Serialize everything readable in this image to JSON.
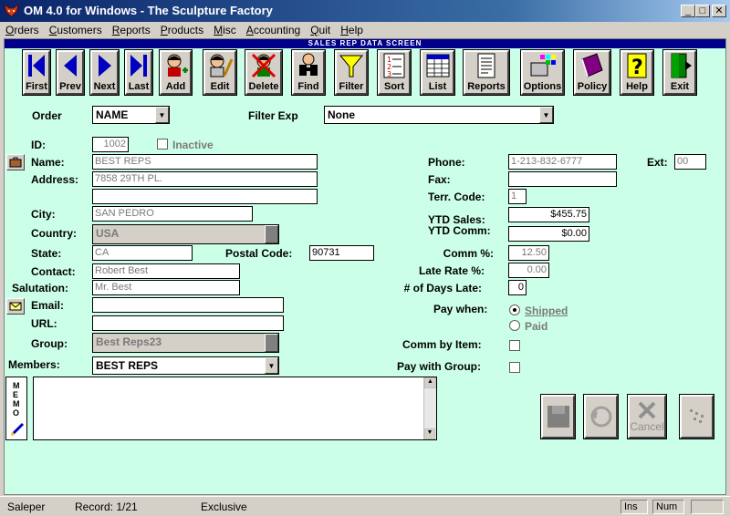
{
  "window": {
    "title": "OM 4.0 for Windows - The Sculpture Factory"
  },
  "menu": [
    "Orders",
    "Customers",
    "Reports",
    "Products",
    "Misc",
    "Accounting",
    "Quit",
    "Help"
  ],
  "screen_title": "SALES REP DATA SCREEN",
  "toolbar": {
    "first": "First",
    "prev": "Prev",
    "next": "Next",
    "last": "Last",
    "add": "Add",
    "edit": "Edit",
    "delete": "Delete",
    "find": "Find",
    "filter": "Filter",
    "sort": "Sort",
    "list": "List",
    "reports": "Reports",
    "options": "Options",
    "policy": "Policy",
    "help": "Help",
    "exit": "Exit"
  },
  "order": {
    "label": "Order",
    "value": "NAME"
  },
  "filter_exp": {
    "label": "Filter Exp",
    "value": "None"
  },
  "form": {
    "id": {
      "label": "ID:",
      "value": "1002"
    },
    "inactive": {
      "label": "Inactive",
      "checked": false
    },
    "name": {
      "label": "Name:",
      "value": "BEST REPS"
    },
    "address": {
      "label": "Address:",
      "line1": "7858 29TH PL.",
      "line2": ""
    },
    "city": {
      "label": "City:",
      "value": "SAN PEDRO"
    },
    "country": {
      "label": "Country:",
      "value": "USA"
    },
    "state": {
      "label": "State:",
      "value": "CA"
    },
    "postal_code": {
      "label": "Postal Code:",
      "value": "90731"
    },
    "contact": {
      "label": "Contact:",
      "value": "Robert Best"
    },
    "salutation": {
      "label": "Salutation:",
      "value": "Mr. Best"
    },
    "email": {
      "label": "Email:",
      "value": ""
    },
    "url": {
      "label": "URL:",
      "value": ""
    },
    "group": {
      "label": "Group:",
      "value": "Best Reps23"
    },
    "members": {
      "label": "Members:",
      "value": "BEST REPS"
    },
    "memo_label": "MEMO",
    "memo": "",
    "phone": {
      "label": "Phone:",
      "value": "1-213-832-6777"
    },
    "ext": {
      "label": "Ext:",
      "value": "00"
    },
    "fax": {
      "label": "Fax:",
      "value": ""
    },
    "terr_code": {
      "label": "Terr. Code:",
      "value": "1"
    },
    "ytd_sales": {
      "label": "YTD Sales:",
      "value": "$455.75"
    },
    "ytd_comm": {
      "label": "YTD Comm:",
      "value": "$0.00"
    },
    "comm_pct": {
      "label": "Comm %:",
      "value": "12.50"
    },
    "late_rate": {
      "label": "Late Rate %:",
      "value": "0.00"
    },
    "days_late": {
      "label": "# of Days Late:",
      "value": "0"
    },
    "pay_when": {
      "label": "Pay when:",
      "options": [
        "Shipped",
        "Paid"
      ],
      "selected": "Shipped"
    },
    "comm_by_item": {
      "label": "Comm by Item:",
      "checked": false
    },
    "pay_with_group": {
      "label": "Pay with Group:",
      "checked": false
    }
  },
  "actions": {
    "cancel": "Cancel"
  },
  "status": {
    "mode": "Saleper",
    "record": "Record: 1/21",
    "lock": "Exclusive",
    "ins": "Ins",
    "num": "Num"
  },
  "colors": {
    "form_bg": "#ccffe8",
    "header_bg": "#00008b",
    "title_bar": "#0a246a"
  }
}
